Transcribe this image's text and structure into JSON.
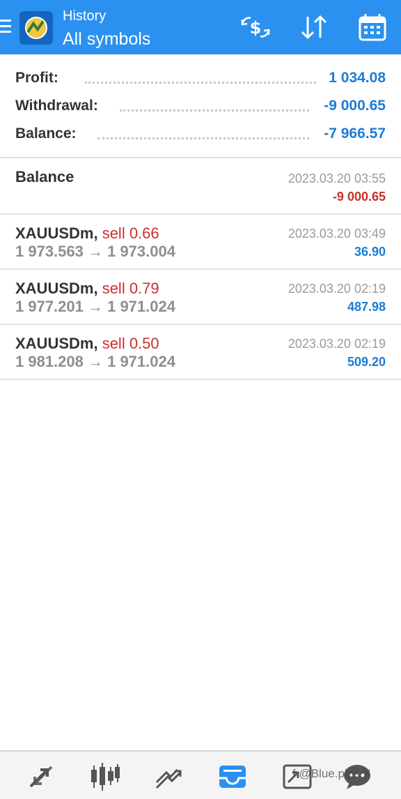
{
  "header": {
    "subtitle": "History",
    "title": "All symbols",
    "background": "#2b91f0",
    "buttons": [
      "currency-exchange-icon",
      "sort-icon",
      "calendar-icon"
    ]
  },
  "summary": {
    "rows": [
      {
        "label": "Profit:",
        "value": "1 034.08"
      },
      {
        "label": "Withdrawal:",
        "value": "-9 000.65"
      },
      {
        "label": "Balance:",
        "value": "-7 966.57"
      }
    ],
    "value_color": "#1c7cd6"
  },
  "deals": [
    {
      "symbol": "Balance",
      "side": "",
      "prices": "",
      "time": "2023.03.20 03:55",
      "profit": "-9 000.65",
      "negative": true
    },
    {
      "symbol": "XAUUSDm,",
      "side": " sell 0.66",
      "prices": "1 973.563 → 1 973.004",
      "time": "2023.03.20 03:49",
      "profit": "36.90",
      "negative": false
    },
    {
      "symbol": "XAUUSDm,",
      "side": " sell 0.79",
      "prices": "1 977.201 → 1 971.024",
      "time": "2023.03.20 02:19",
      "profit": "487.98",
      "negative": false
    },
    {
      "symbol": "XAUUSDm,",
      "side": " sell 0.50",
      "prices": "1 981.208 → 1 971.024",
      "time": "2023.03.20 02:19",
      "profit": "509.20",
      "negative": false
    }
  ],
  "colors": {
    "sell": "#c9302c",
    "profit_positive": "#1c7cd6",
    "profit_negative": "#c9302c",
    "active_tab": "#2b91f0"
  },
  "bottom_nav": [
    {
      "name": "quotes-icon",
      "active": false
    },
    {
      "name": "chart-icon",
      "active": false
    },
    {
      "name": "trade-icon",
      "active": false
    },
    {
      "name": "history-icon",
      "active": true
    },
    {
      "name": "news-icon",
      "active": false
    },
    {
      "name": "messages-icon",
      "active": false
    }
  ],
  "watermark": "f @Blue.pips X"
}
